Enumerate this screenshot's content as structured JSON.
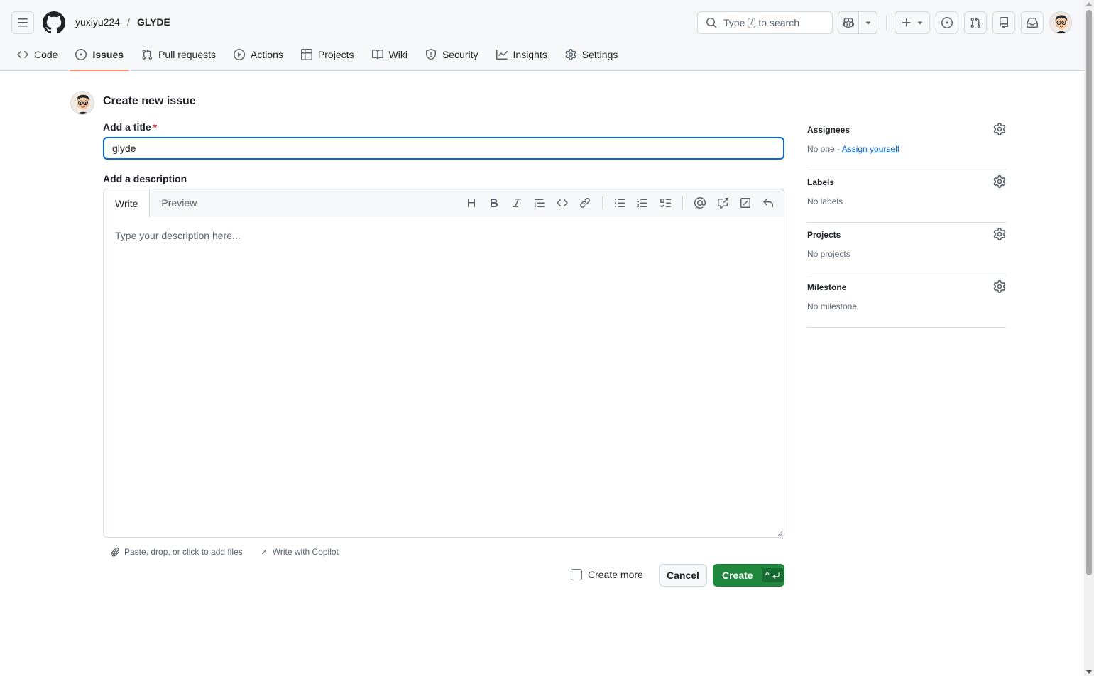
{
  "header": {
    "owner": "yuxiyu224",
    "separator": "/",
    "repo": "GLYDE",
    "search": {
      "prefix": "Type",
      "key": "/",
      "suffix": "to search"
    }
  },
  "tabs": [
    {
      "label": "Code",
      "icon": "code-icon"
    },
    {
      "label": "Issues",
      "icon": "issue-opened-icon",
      "active": true
    },
    {
      "label": "Pull requests",
      "icon": "git-pull-request-icon"
    },
    {
      "label": "Actions",
      "icon": "play-icon"
    },
    {
      "label": "Projects",
      "icon": "table-icon"
    },
    {
      "label": "Wiki",
      "icon": "book-icon"
    },
    {
      "label": "Security",
      "icon": "shield-icon"
    },
    {
      "label": "Insights",
      "icon": "graph-icon"
    },
    {
      "label": "Settings",
      "icon": "gear-icon"
    }
  ],
  "form": {
    "page_title": "Create new issue",
    "title_label": "Add a title",
    "required_mark": "*",
    "title_value": "glyde",
    "description_label": "Add a description",
    "write_tab": "Write",
    "preview_tab": "Preview",
    "description_placeholder": "Type your description here...",
    "attach_text": "Paste, drop, or click to add files",
    "copilot_text": "Write with Copilot",
    "create_more": "Create more",
    "cancel": "Cancel",
    "create": "Create",
    "create_hint": "^"
  },
  "sidebar": {
    "assignees": {
      "title": "Assignees",
      "value": "No one -",
      "link": "Assign yourself"
    },
    "labels": {
      "title": "Labels",
      "value": "No labels"
    },
    "projects": {
      "title": "Projects",
      "value": "No projects"
    },
    "milestone": {
      "title": "Milestone",
      "value": "No milestone"
    }
  },
  "colors": {
    "accent": "#0969da",
    "primary_button": "#1f883d",
    "active_tab_underline": "#fd8c73",
    "required": "#d1242f"
  }
}
